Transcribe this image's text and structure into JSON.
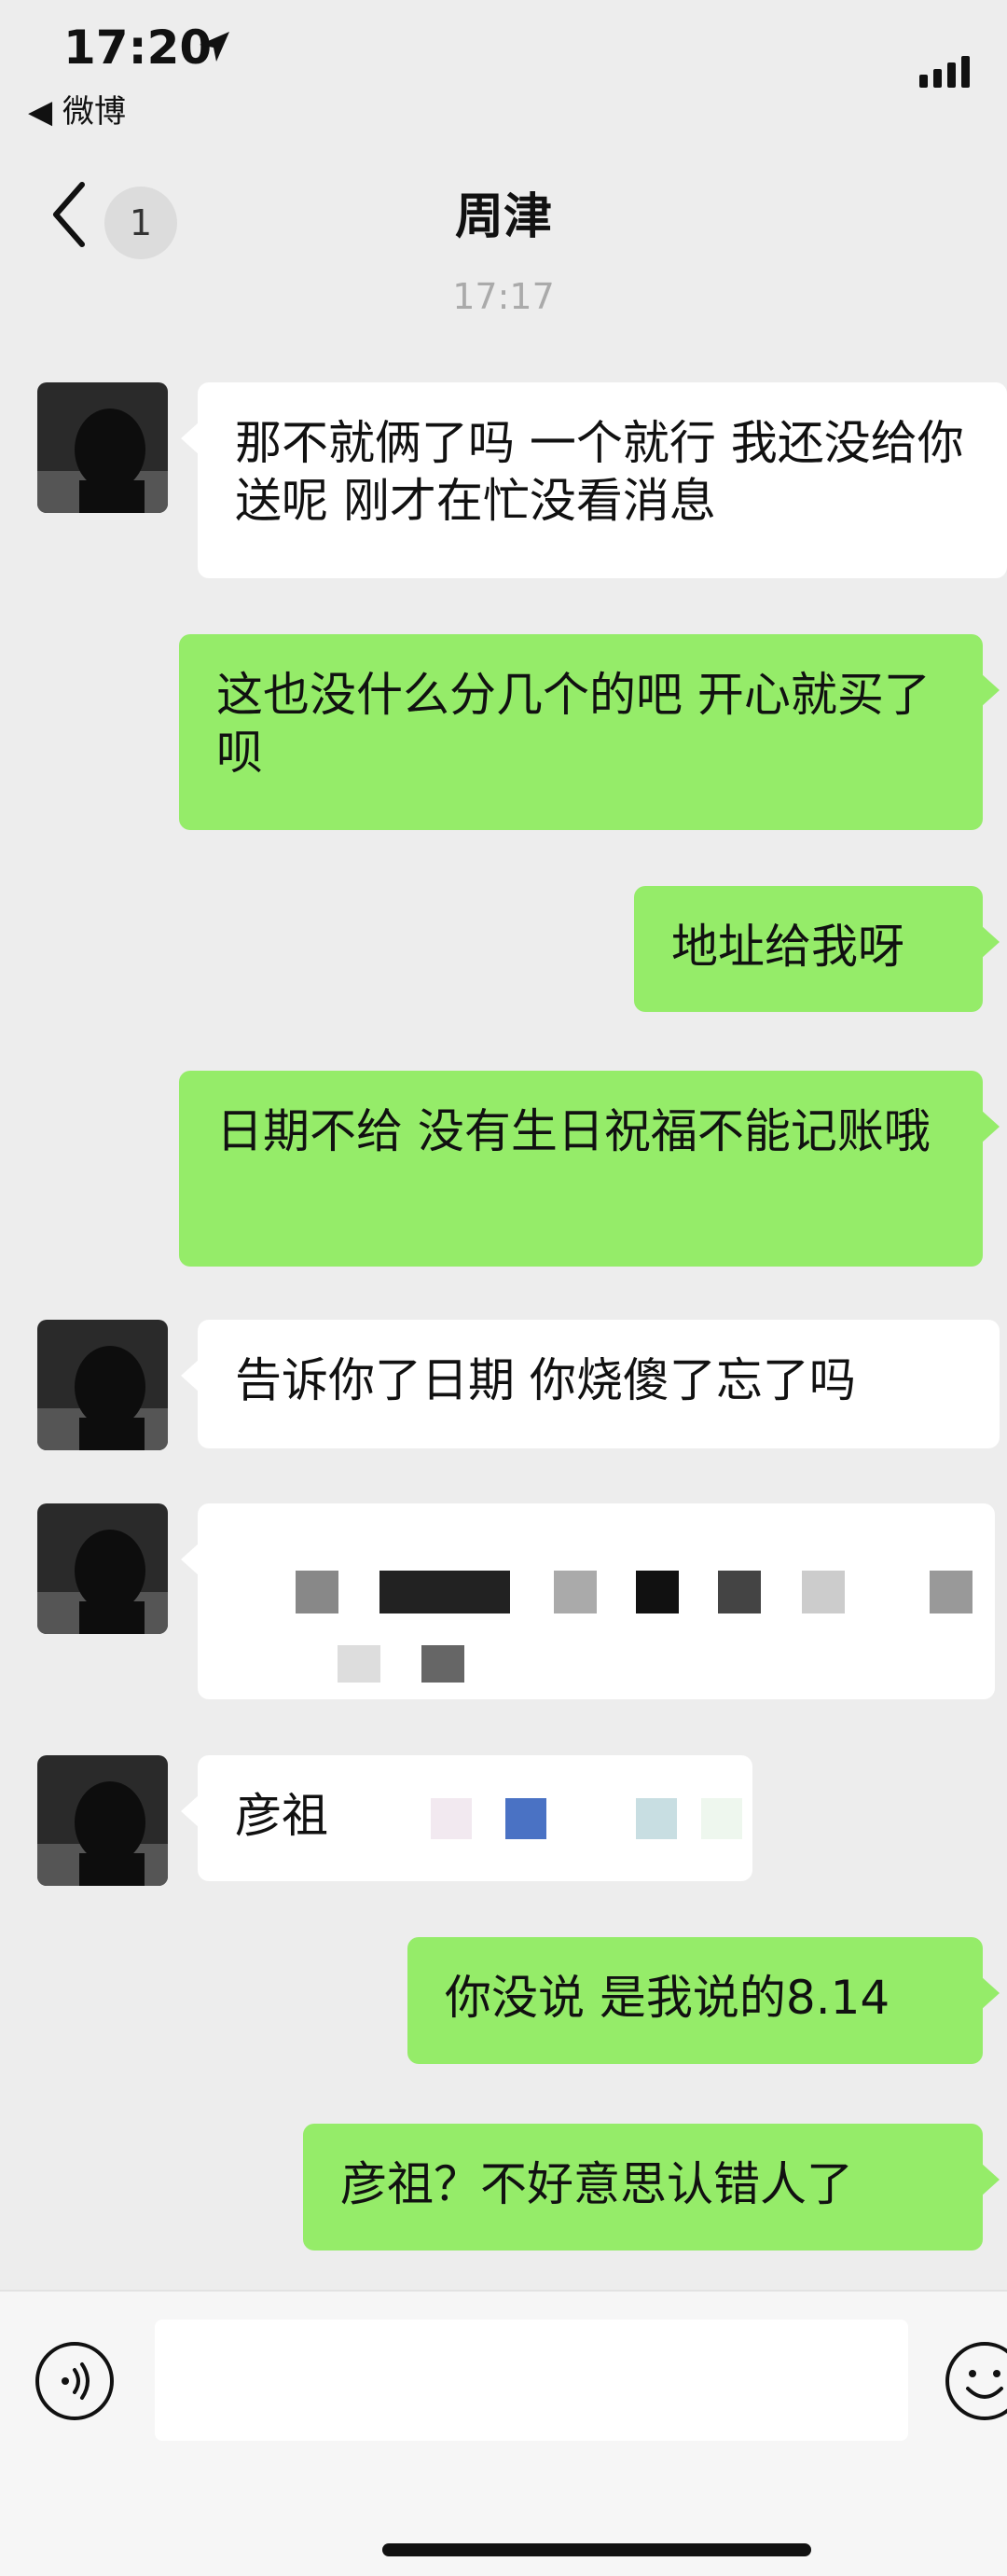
{
  "status_bar": {
    "time": "17:20",
    "back_app": "◀ 微博"
  },
  "nav": {
    "unread_count": "1",
    "title": "周津"
  },
  "timestamp": "17:17",
  "messages": [
    {
      "side": "in",
      "text": "那不就俩了吗 一个就行 我还没给你送呢 刚才在忙没看消息"
    },
    {
      "side": "out",
      "text": "这也没什么分几个的吧 开心就买了呗"
    },
    {
      "side": "out",
      "text": "地址给我呀"
    },
    {
      "side": "out",
      "text": "日期不给 没有生日祝福不能记账哦"
    },
    {
      "side": "in",
      "text": "告诉你了日期 你烧傻了忘了吗"
    },
    {
      "side": "in",
      "text": ""
    },
    {
      "side": "in",
      "text": "彦祖"
    },
    {
      "side": "out",
      "text": "你没说 是我说的8.14"
    },
    {
      "side": "out",
      "text": "彦祖？不好意思认错人了"
    }
  ],
  "colors": {
    "background": "#ededed",
    "incoming_bubble": "#ffffff",
    "outgoing_bubble": "#95ec69",
    "timestamp": "#aaaaaa"
  },
  "icons": [
    "location-arrow-icon",
    "signal-icon",
    "back-chevron-icon",
    "voice-icon",
    "emoji-icon"
  ]
}
